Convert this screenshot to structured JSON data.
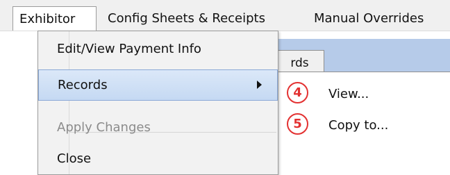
{
  "menu_bar": {
    "items": [
      {
        "label": "Exhibitor"
      },
      {
        "label": "Config Sheets & Receipts"
      },
      {
        "label": "Manual Overrides"
      }
    ]
  },
  "dropdown": {
    "items": [
      {
        "label": "Edit/View Payment Info",
        "state": "normal"
      },
      {
        "label": "Records",
        "state": "selected",
        "has_submenu": true
      },
      {
        "label": "Apply Changes",
        "state": "disabled"
      },
      {
        "label": "Close",
        "state": "normal"
      }
    ]
  },
  "background_tab": {
    "label": "rds"
  },
  "submenu": {
    "items": [
      {
        "badge": "4",
        "label": "View..."
      },
      {
        "badge": "5",
        "label": "Copy to..."
      }
    ]
  },
  "colors": {
    "menu_bar_background": "#f0f0f0",
    "dropdown_background": "#f2f2f2",
    "selected_highlight": "#c5d9f3",
    "selected_border": "#8aa8d6",
    "disabled_text": "#8b8b8b",
    "background_strip": "#b6cbe9",
    "badge_red": "#e33131"
  },
  "icons": {
    "submenu_indicator": "chevron-right-icon"
  }
}
